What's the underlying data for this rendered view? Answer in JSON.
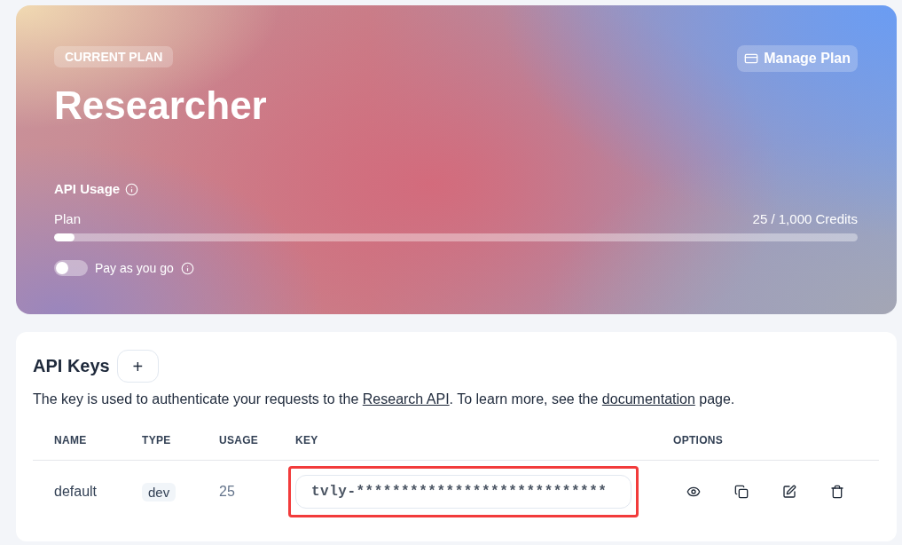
{
  "plan_card": {
    "badge": "CURRENT PLAN",
    "manage_button": "Manage Plan",
    "plan_name": "Researcher",
    "usage": {
      "title": "API Usage",
      "meter_label": "Plan",
      "reading": "25 / 1,000 Credits",
      "level": 0.025
    },
    "pay_as_you_go": {
      "label": "Pay as you go",
      "on": false
    }
  },
  "api_keys": {
    "title": "API Keys",
    "add_button": "+",
    "description": [
      {
        "kind": "text",
        "text": "The key is used to authenticate your requests to the "
      },
      {
        "kind": "link",
        "text": "Research API"
      },
      {
        "kind": "text",
        "text": ". To learn more, see the "
      },
      {
        "kind": "link",
        "text": "documentation"
      },
      {
        "kind": "text",
        "text": " page."
      }
    ],
    "table": {
      "columns": [
        "NAME",
        "TYPE",
        "USAGE",
        "KEY",
        "OPTIONS"
      ],
      "rows": [
        {
          "name": "default",
          "type": "dev",
          "usage": "25",
          "key": "tvly-****************************",
          "highlighted": true
        }
      ]
    }
  }
}
